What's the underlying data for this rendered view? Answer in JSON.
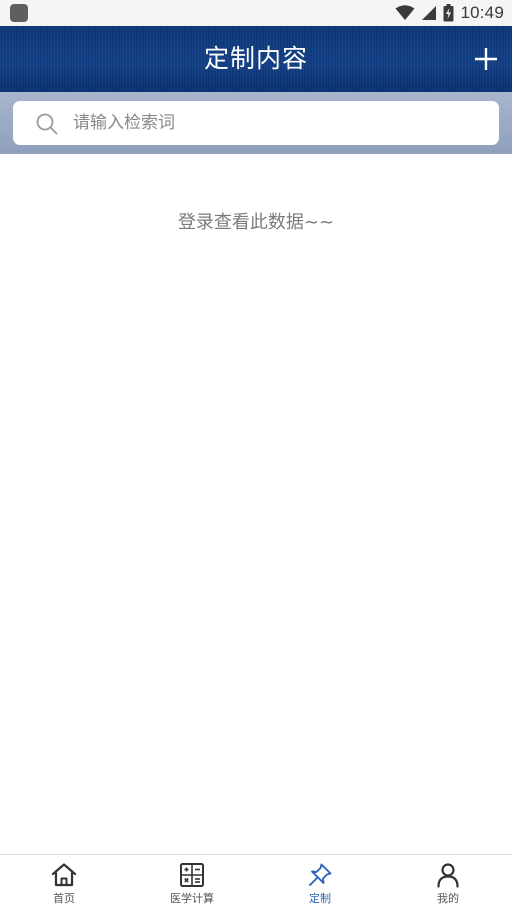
{
  "status_bar": {
    "time": "10:49"
  },
  "header": {
    "title": "定制内容",
    "add_icon": "plus-icon"
  },
  "search": {
    "placeholder": "请输入检索词",
    "value": "",
    "icon": "search-icon"
  },
  "content": {
    "empty_message": "登录查看此数据~~"
  },
  "tabs": [
    {
      "label": "首页",
      "icon": "home-icon",
      "active": false
    },
    {
      "label": "医学计算",
      "icon": "calculator-icon",
      "active": false
    },
    {
      "label": "定制",
      "icon": "pin-icon",
      "active": true
    },
    {
      "label": "我的",
      "icon": "user-icon",
      "active": false
    }
  ],
  "colors": {
    "header": "#0c3678",
    "active_tab": "#2a64b8",
    "inactive_tab": "#333333"
  }
}
